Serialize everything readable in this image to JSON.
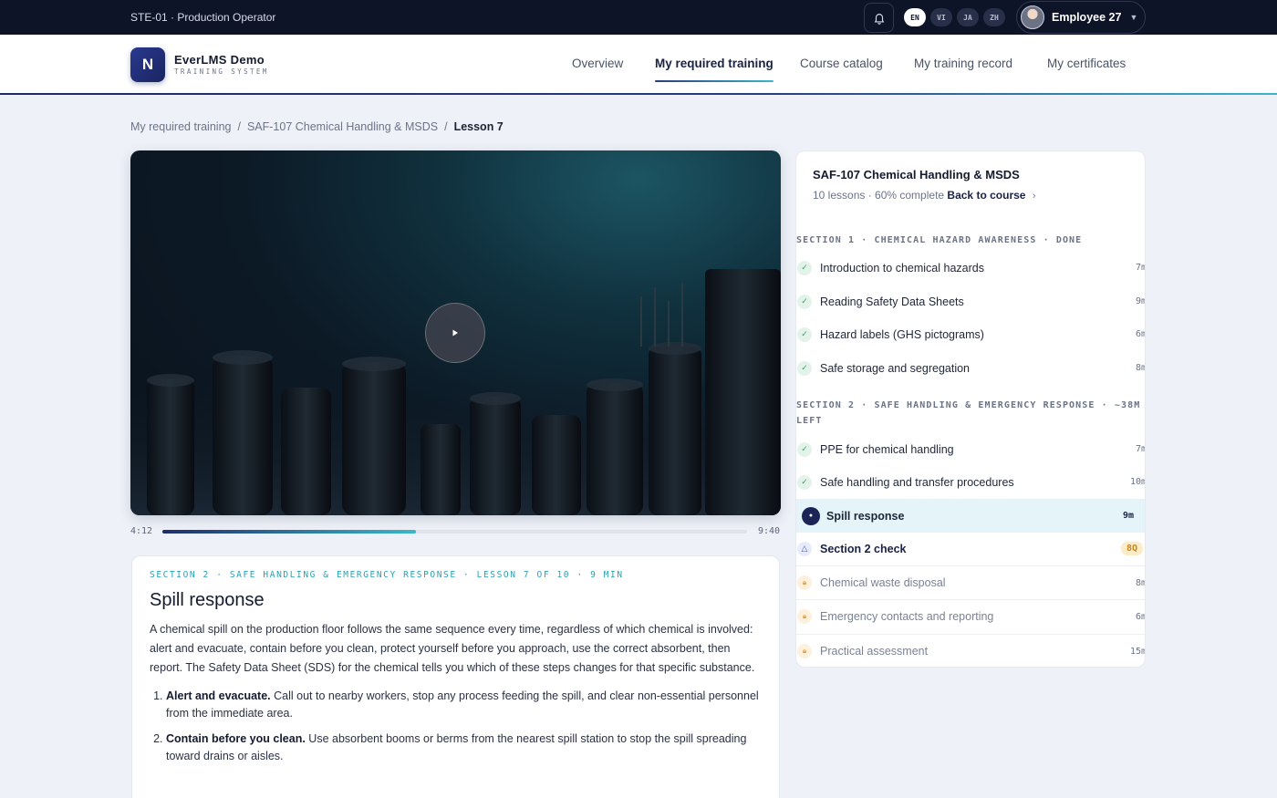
{
  "topbar": {
    "station": "STE-01 · Production Operator",
    "languages": [
      "EN",
      "VI",
      "JA",
      "ZH"
    ],
    "active_language": "EN",
    "user_name": "Employee 27",
    "icons": {
      "notifications": "bell-icon",
      "menu": "chevron-down-icon"
    }
  },
  "header": {
    "logo_letter": "N",
    "brand_name": "EverLMS Demo",
    "brand_sub": "TRAINING SYSTEM",
    "nav": [
      {
        "label": "Overview"
      },
      {
        "label": "My required training"
      },
      {
        "label": "Course catalog"
      },
      {
        "label": "My training record"
      },
      {
        "label": "My certificates"
      }
    ],
    "active_nav": "My required training"
  },
  "breadcrumb": {
    "items": [
      "My required training",
      "SAF-107 Chemical Handling & MSDS",
      "Lesson 7"
    ],
    "separator": "/"
  },
  "player": {
    "current_time": "4:12",
    "duration": "9:40",
    "progress_fraction": 0.434
  },
  "lesson": {
    "kicker": "SECTION 2 · SAFE HANDLING & EMERGENCY RESPONSE · LESSON 7 OF 10 · 9 MIN",
    "title": "Spill response",
    "intro": "A chemical spill on the production floor follows the same sequence every time, regardless of which chemical is involved: alert and evacuate, contain before you clean, protect yourself before you approach, use the correct absorbent, then report. The Safety Data Sheet (SDS) for the chemical tells you which of these steps changes for that specific substance.",
    "steps": [
      {
        "title": "Alert and evacuate.",
        "text": "Call out to nearby workers, stop any process feeding the spill, and clear non-essential personnel from the immediate area."
      },
      {
        "title": "Contain before you clean.",
        "text": "Use absorbent booms or berms from the nearest spill station to stop the spill spreading toward drains or aisles."
      }
    ]
  },
  "course": {
    "title": "SAF-107 Chemical Handling & MSDS",
    "meta": "10 lessons · 60% complete",
    "back_label": "Back to course",
    "sections": [
      {
        "heading": "SECTION 1 · CHEMICAL HAZARD AWARENESS · DONE",
        "items": [
          {
            "label": "Introduction to chemical hazards",
            "duration": "7m",
            "state": "done"
          },
          {
            "label": "Reading Safety Data Sheets",
            "duration": "9m",
            "state": "done"
          },
          {
            "label": "Hazard labels (GHS pictograms)",
            "duration": "6m",
            "state": "done"
          },
          {
            "label": "Safe storage and segregation",
            "duration": "8m",
            "state": "done"
          }
        ]
      },
      {
        "heading": "SECTION 2 · SAFE HANDLING & EMERGENCY RESPONSE · ~38M LEFT",
        "items": [
          {
            "label": "PPE for chemical handling",
            "duration": "7m",
            "state": "done"
          },
          {
            "label": "Safe handling and transfer procedures",
            "duration": "10m",
            "state": "done"
          },
          {
            "label": "Spill response",
            "duration": "9m",
            "state": "current"
          },
          {
            "label": "Section 2 check",
            "duration": "8Q",
            "state": "quiz"
          },
          {
            "label": "Chemical waste disposal",
            "duration": "8m",
            "state": "locked"
          },
          {
            "label": "Emergency contacts and reporting",
            "duration": "6m",
            "state": "locked"
          },
          {
            "label": "Practical assessment",
            "duration": "15m",
            "state": "locked"
          }
        ]
      }
    ]
  },
  "colors": {
    "topbar_bg": "#0e1428",
    "accent": "#1a2456",
    "accent_teal": "#3ab7c9",
    "done_green": "#3aa36a",
    "locked_amber": "#e1a34a",
    "current_row_bg": "#e4f4f8"
  }
}
